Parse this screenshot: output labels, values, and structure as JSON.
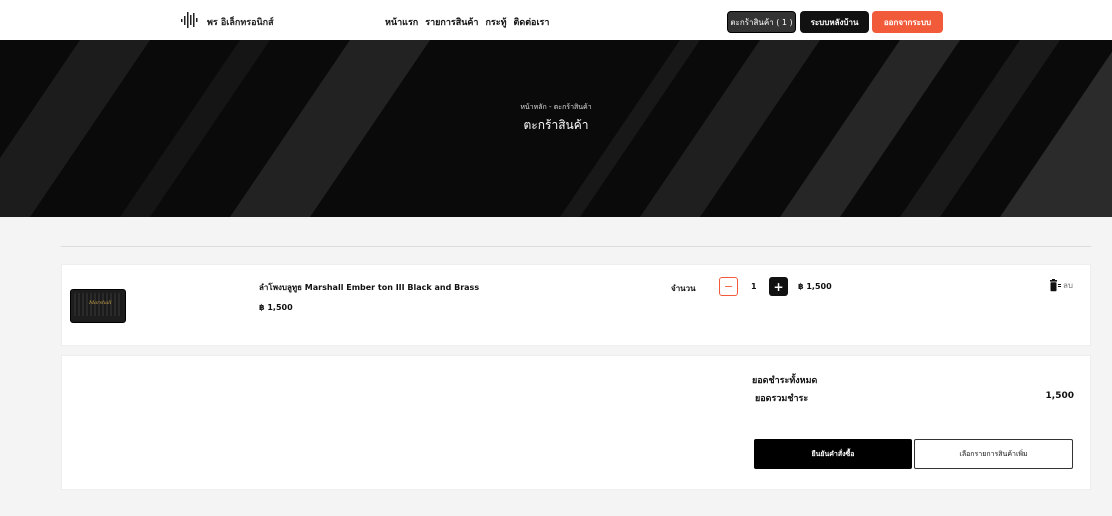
{
  "header": {
    "brand": "พร อิเล็กทรอนิกส์",
    "nav": [
      "หน้าแรก",
      "รายการสินค้า",
      "กระทู้",
      "ติดต่อเรา"
    ],
    "cart_button": "ตะกร้าสินค้า ( 1 )",
    "admin_button": "ระบบหลังบ้าน",
    "logout_button": "ออกจากระบบ"
  },
  "hero": {
    "breadcrumb": "หน้าหลัก - ตะกร้าสินค้า",
    "title": "ตะกร้าสินค้า"
  },
  "cart": {
    "items": [
      {
        "name": "ลำโพงบลูทูธ Marshall Ember ton III Black and Brass",
        "price": "฿ 1,500",
        "qty_label": "จำนวน",
        "qty": "1",
        "line_total": "฿ 1,500",
        "delete_label": "ลบ",
        "image_brand": "Marshall"
      }
    ]
  },
  "summary": {
    "title": "ยอดชำระทั้งหมด",
    "total_label": "ยอดรวมชำระ",
    "total_value": "1,500",
    "confirm_button": "ยืนยันคำสั่งซื้อ",
    "more_button": "เลือกรายการสินค้าเพิ่ม"
  },
  "colors": {
    "accent": "#f25b3a",
    "dark": "#111111",
    "hero_bg": "#0a0a0a"
  }
}
